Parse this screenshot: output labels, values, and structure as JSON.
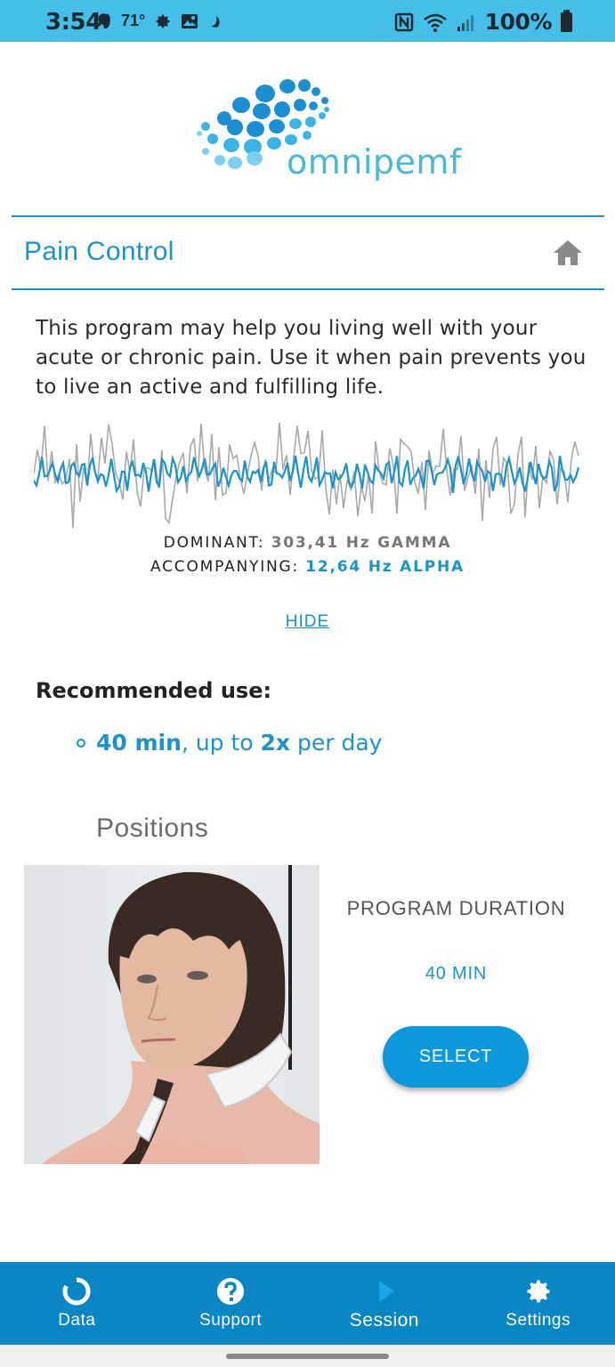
{
  "status_bar": {
    "time": "3:54",
    "temperature": "71°",
    "battery": "100%",
    "left_icons": [
      "evernote-icon",
      "settings-gear-icon",
      "image-icon",
      "moon-icon"
    ],
    "right_icons": [
      "nfc-icon",
      "wifi-icon",
      "signal-icon",
      "battery-icon"
    ]
  },
  "logo": {
    "text": "omnipemf"
  },
  "header": {
    "title": "Pain Control"
  },
  "description": "This program may help you living well with your acute or chronic pain. Use it when pain prevents you to live an active and fulfilling life.",
  "frequencies": {
    "dominant_label": "DOMINANT:",
    "dominant_value": "303,41 Hz GAMMA",
    "accompanying_label": "ACCOMPANYING:",
    "accompanying_value": "12,64 Hz ALPHA"
  },
  "hide_link": "HIDE",
  "recommended": {
    "heading": "Recommended use:",
    "duration": "40 min",
    "middle": ", up to ",
    "times": "2x",
    "suffix": " per day"
  },
  "positions": {
    "heading": "Positions",
    "duration_label": "PROGRAM DURATION",
    "duration_value": "40 MIN",
    "select_label": "SELECT"
  },
  "bottom_nav": {
    "items": [
      {
        "label": "Data",
        "icon": "data-ring-icon"
      },
      {
        "label": "Support",
        "icon": "help-circle-icon"
      },
      {
        "label": "Session",
        "icon": "play-icon",
        "active": true
      },
      {
        "label": "Settings",
        "icon": "gear-icon"
      }
    ]
  },
  "colors": {
    "status_bar": "#45bfe7",
    "accent": "#1b93c9",
    "button": "#0b98dd",
    "nav": "#0b86c4"
  }
}
